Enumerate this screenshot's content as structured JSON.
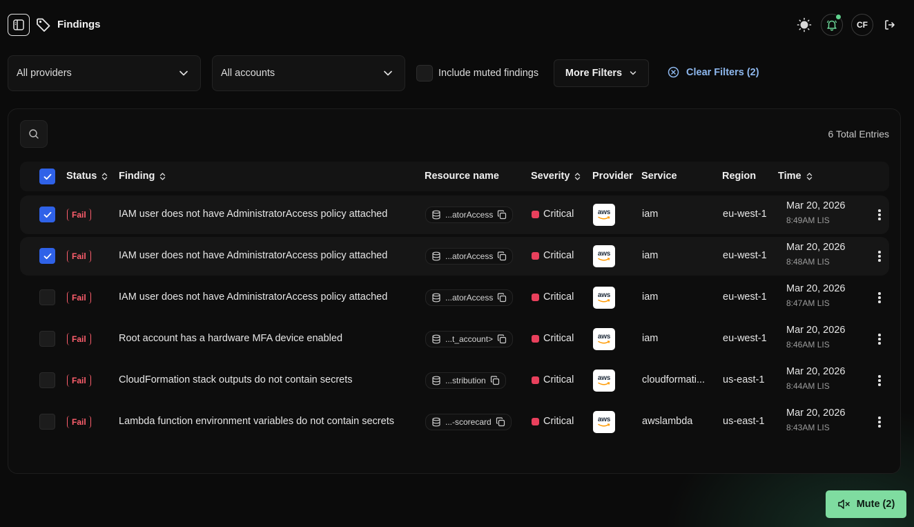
{
  "header": {
    "title": "Findings",
    "user_initials": "CF",
    "icons": [
      "sidebar-toggle-icon",
      "tag-icon",
      "sun-icon",
      "bell-icon",
      "logout-icon"
    ]
  },
  "filters": {
    "providers": "All providers",
    "accounts": "All accounts",
    "include_muted_label": "Include muted findings",
    "include_muted_checked": false,
    "more_filters": "More Filters",
    "clear_filters": "Clear Filters (2)"
  },
  "table": {
    "total_entries": "6 Total Entries",
    "columns": {
      "status": "Status",
      "finding": "Finding",
      "resource": "Resource name",
      "severity": "Severity",
      "provider": "Provider",
      "service": "Service",
      "region": "Region",
      "time": "Time"
    },
    "rows": [
      {
        "selected": true,
        "status": "Fail",
        "finding": "IAM user does not have AdministratorAccess policy attached",
        "resource": "...atorAccess",
        "severity": "Critical",
        "provider": "aws",
        "service": "iam",
        "region": "eu-west-1",
        "date": "Mar 20, 2026",
        "time": "8:49AM LIS"
      },
      {
        "selected": true,
        "status": "Fail",
        "finding": "IAM user does not have AdministratorAccess policy attached",
        "resource": "...atorAccess",
        "severity": "Critical",
        "provider": "aws",
        "service": "iam",
        "region": "eu-west-1",
        "date": "Mar 20, 2026",
        "time": "8:48AM LIS"
      },
      {
        "selected": false,
        "status": "Fail",
        "finding": "IAM user does not have AdministratorAccess policy attached",
        "resource": "...atorAccess",
        "severity": "Critical",
        "provider": "aws",
        "service": "iam",
        "region": "eu-west-1",
        "date": "Mar 20, 2026",
        "time": "8:47AM LIS"
      },
      {
        "selected": false,
        "status": "Fail",
        "finding": "Root account has a hardware MFA device enabled",
        "resource": "...t_account>",
        "severity": "Critical",
        "provider": "aws",
        "service": "iam",
        "region": "eu-west-1",
        "date": "Mar 20, 2026",
        "time": "8:46AM LIS"
      },
      {
        "selected": false,
        "status": "Fail",
        "finding": "CloudFormation stack outputs do not contain secrets",
        "resource": "...stribution",
        "severity": "Critical",
        "provider": "aws",
        "service": "cloudformati...",
        "region": "us-east-1",
        "date": "Mar 20, 2026",
        "time": "8:44AM LIS"
      },
      {
        "selected": false,
        "status": "Fail",
        "finding": "Lambda function environment variables do not contain secrets",
        "resource": "...-scorecard",
        "severity": "Critical",
        "provider": "aws",
        "service": "awslambda",
        "region": "us-east-1",
        "date": "Mar 20, 2026",
        "time": "8:43AM LIS"
      }
    ]
  },
  "mute_button": "Mute (2)",
  "colors": {
    "accent_blue": "#2f62e8",
    "fail_red": "#ff5f6d",
    "critical": "#e8405c",
    "mute_green": "#7fdca0",
    "link_blue": "#8eb8ee"
  }
}
